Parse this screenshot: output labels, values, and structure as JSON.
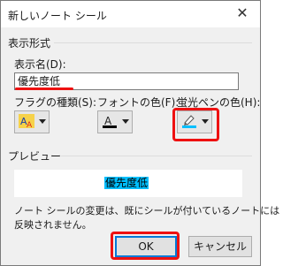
{
  "dialog": {
    "title": "新しいノート シール",
    "close_glyph": "✕"
  },
  "group_display": {
    "label": "表示形式",
    "name_label": "表示名(D):",
    "name_value": "優先度低",
    "flag_type_label": "フラグの種類(S):",
    "font_color_label": "フォントの色(F):",
    "highlight_color_label": "蛍光ペンの色(H):"
  },
  "combos": {
    "flag_icon": "flag-type-icon",
    "font_color_icon": "font-color-icon",
    "highlight_icon": "highlighter-icon",
    "font_color_glyph": "A",
    "flag_glyph": "A"
  },
  "group_preview": {
    "label": "プレビュー",
    "preview_text": "優先度低",
    "note_line1": "ノート シールの変更は、既にシールが付いているノートには",
    "note_line2": "反映されません。"
  },
  "buttons": {
    "ok_label": "OK",
    "cancel_label": "キャンセル"
  },
  "colors": {
    "highlight": "#00bfff",
    "annotation_red": "#ee1111"
  }
}
